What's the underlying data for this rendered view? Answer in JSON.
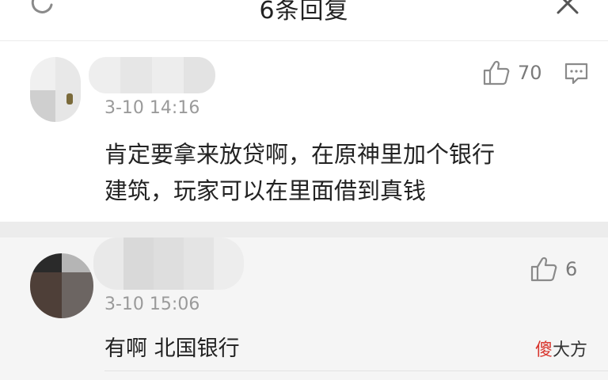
{
  "header": {
    "title": "6条回复",
    "refresh_icon": "refresh-icon",
    "close_icon": "close-icon"
  },
  "main_comment": {
    "timestamp": "3-10 14:16",
    "text_line1": "肯定要拿来放贷啊，在原神里加个银行",
    "text_line2": "建筑，玩家可以在里面借到真钱",
    "like_count": "70",
    "like_icon": "thumbs-up-icon",
    "reply_icon": "comment-icon"
  },
  "reply": {
    "timestamp": "3-10 15:06",
    "text": "有啊 北国银行",
    "like_count": "6",
    "like_icon": "thumbs-up-icon"
  },
  "watermark": {
    "accent": "傻",
    "rest": "大方"
  },
  "colors": {
    "divider": "#ececec",
    "reply_background": "#f5f5f5",
    "muted_text": "#9a9a9a",
    "watermark_accent": "#d8342c"
  }
}
